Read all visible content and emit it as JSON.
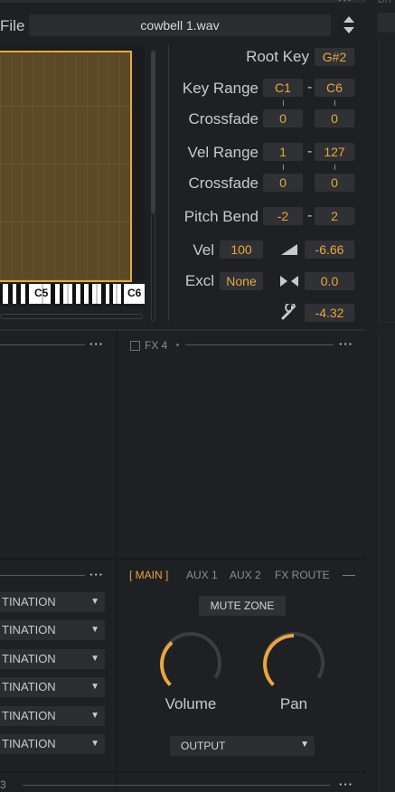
{
  "header": {
    "file_label": "File",
    "file_name": "cowbell 1.wav",
    "dots": "···",
    "top_label": "BR"
  },
  "keyboard": {
    "label_c5": "C5",
    "label_c6": "C6"
  },
  "params": {
    "root_key_label": "Root Key",
    "root_key_value": "G#2",
    "key_range_label": "Key Range",
    "key_range_low": "C1",
    "key_range_high": "C6",
    "key_crossfade_label": "Crossfade",
    "key_crossfade_low": "0",
    "key_crossfade_high": "0",
    "vel_range_label": "Vel Range",
    "vel_range_low": "1",
    "vel_range_high": "127",
    "vel_crossfade_label": "Crossfade",
    "vel_crossfade_low": "0",
    "vel_crossfade_high": "0",
    "pitch_bend_label": "Pitch Bend",
    "pitch_bend_low": "-2",
    "pitch_bend_high": "2",
    "vel_label": "Vel",
    "vel_value": "100",
    "volume_db": "-6.66",
    "excl_label": "Excl",
    "excl_value": "None",
    "pan_value": "0.0",
    "tune_value": "-4.32",
    "dash": "-"
  },
  "fx": {
    "fx4_label": "FX 4",
    "dots": "···"
  },
  "destinations": {
    "items": [
      "TINATION",
      "TINATION",
      "TINATION",
      "TINATION",
      "TINATION",
      "TINATION"
    ],
    "dots": "···"
  },
  "routing": {
    "tabs": [
      "[ MAIN ]",
      "AUX 1",
      "AUX 2",
      "FX ROUTE"
    ],
    "mute_zone": "MUTE ZONE",
    "volume_label": "Volume",
    "pan_label": "Pan",
    "output_label": "OUTPUT",
    "volume_level": 0.35,
    "pan_level": 0.5
  },
  "footer": {
    "label": "3",
    "dots": "···"
  },
  "colors": {
    "accent": "#e9a73b",
    "waveform_fill": "#5c4a26"
  }
}
